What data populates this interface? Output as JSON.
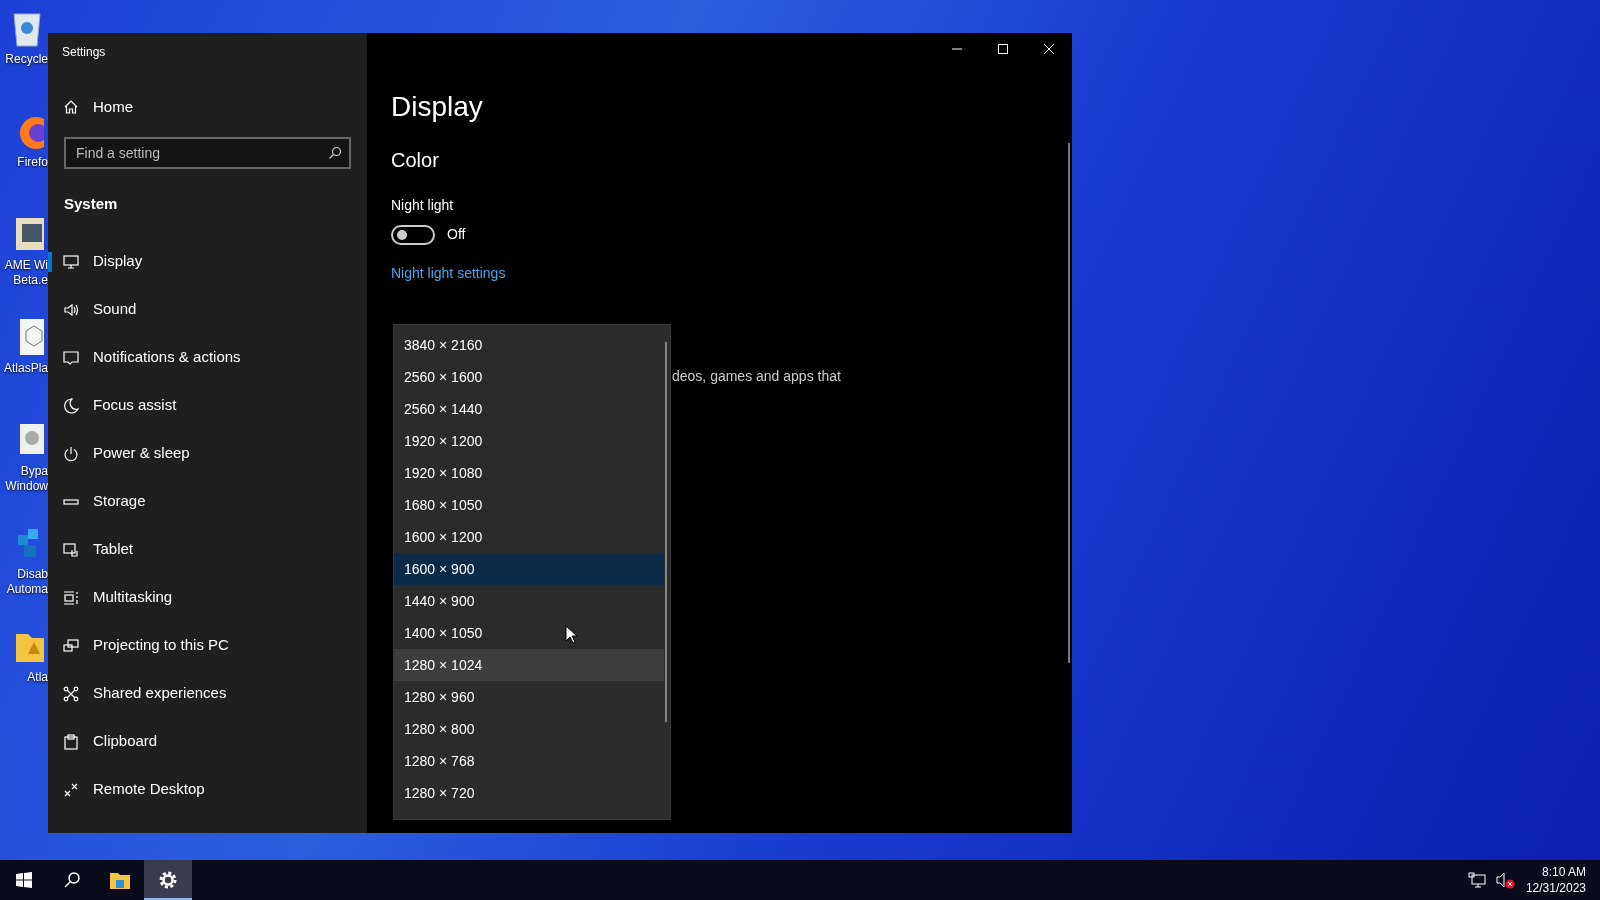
{
  "desktop_icons": [
    {
      "lines": [
        "Recycle"
      ]
    },
    {
      "lines": [
        "Firefo"
      ]
    },
    {
      "lines": [
        "AME Wi",
        "Beta.e"
      ]
    },
    {
      "lines": [
        "AtlasPla"
      ]
    },
    {
      "lines": [
        "Bypa",
        "Window"
      ]
    },
    {
      "lines": [
        "Disab",
        "Automa"
      ]
    },
    {
      "lines": [
        "Atla"
      ]
    }
  ],
  "window": {
    "title": "Settings"
  },
  "sidebar": {
    "home": "Home",
    "search": {
      "placeholder": "Find a setting"
    },
    "section": "System",
    "items": [
      {
        "label": "Display",
        "selected": true
      },
      {
        "label": "Sound",
        "selected": false
      },
      {
        "label": "Notifications & actions",
        "selected": false
      },
      {
        "label": "Focus assist",
        "selected": false
      },
      {
        "label": "Power & sleep",
        "selected": false
      },
      {
        "label": "Storage",
        "selected": false
      },
      {
        "label": "Tablet",
        "selected": false
      },
      {
        "label": "Multitasking",
        "selected": false
      },
      {
        "label": "Projecting to this PC",
        "selected": false
      },
      {
        "label": "Shared experiences",
        "selected": false
      },
      {
        "label": "Clipboard",
        "selected": false
      },
      {
        "label": "Remote Desktop",
        "selected": false
      }
    ]
  },
  "content": {
    "title": "Display",
    "section": "Color",
    "night_light": {
      "label": "Night light",
      "on": false,
      "state_text": "Off"
    },
    "link": "Night light settings",
    "partial_text": "deos, games and apps that"
  },
  "resolution_dropdown": {
    "options": [
      {
        "label": "3840 × 2160",
        "selected": false,
        "hovered": false
      },
      {
        "label": "2560 × 1600",
        "selected": false,
        "hovered": false
      },
      {
        "label": "2560 × 1440",
        "selected": false,
        "hovered": false
      },
      {
        "label": "1920 × 1200",
        "selected": false,
        "hovered": false
      },
      {
        "label": "1920 × 1080",
        "selected": false,
        "hovered": false
      },
      {
        "label": "1680 × 1050",
        "selected": false,
        "hovered": false
      },
      {
        "label": "1600 × 1200",
        "selected": false,
        "hovered": false
      },
      {
        "label": "1600 × 900",
        "selected": true,
        "hovered": false
      },
      {
        "label": "1440 × 900",
        "selected": false,
        "hovered": false
      },
      {
        "label": "1400 × 1050",
        "selected": false,
        "hovered": false
      },
      {
        "label": "1280 × 1024",
        "selected": false,
        "hovered": true
      },
      {
        "label": "1280 × 960",
        "selected": false,
        "hovered": false
      },
      {
        "label": "1280 × 800",
        "selected": false,
        "hovered": false
      },
      {
        "label": "1280 × 768",
        "selected": false,
        "hovered": false
      },
      {
        "label": "1280 × 720",
        "selected": false,
        "hovered": false
      }
    ]
  },
  "taskbar": {
    "pinned": [
      {
        "selected": false
      },
      {
        "selected": true
      }
    ],
    "sound_muted": true,
    "time": "8:10 AM",
    "date": "12/31/2023"
  }
}
